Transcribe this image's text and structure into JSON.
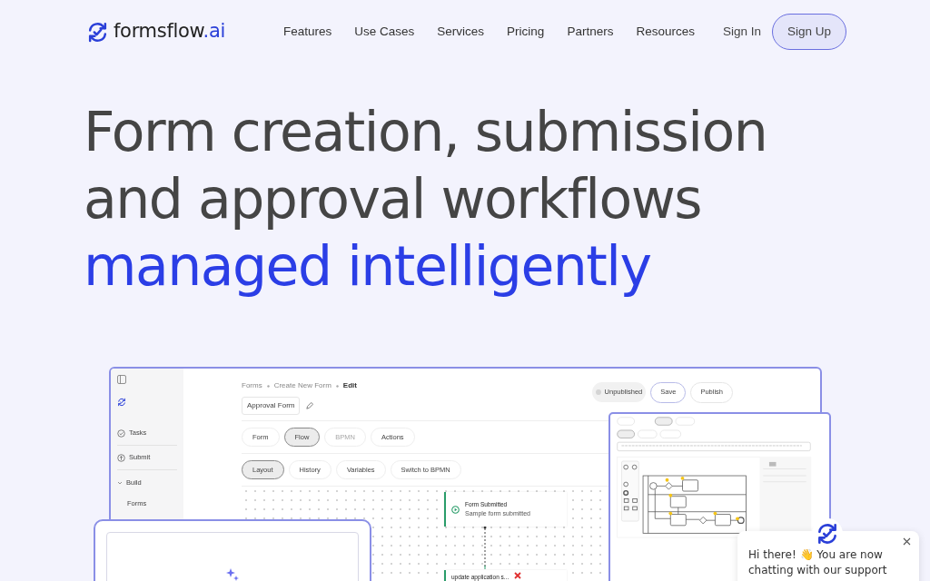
{
  "header": {
    "brand": "formsflow",
    "brand_suffix": ".ai",
    "nav": [
      {
        "label": "Features"
      },
      {
        "label": "Use Cases"
      },
      {
        "label": "Services"
      },
      {
        "label": "Pricing"
      },
      {
        "label": "Partners"
      },
      {
        "label": "Resources"
      }
    ],
    "sign_in": "Sign In",
    "sign_up": "Sign Up"
  },
  "headline": [
    {
      "text": "Form creation, submission",
      "highlight": false
    },
    {
      "text": "and approval workflows",
      "highlight": false
    },
    {
      "text": "managed intelligently",
      "highlight": true
    }
  ],
  "mockup": {
    "sidebar": [
      {
        "label": "Tasks",
        "kind": "check"
      },
      {
        "label": "Submit",
        "kind": "upload"
      },
      {
        "label": "Build",
        "kind": "group",
        "expanded": true
      },
      {
        "label": "Forms",
        "kind": "sub"
      }
    ],
    "breadcrumb": [
      "Forms",
      "Create New Form",
      "Edit"
    ],
    "form_name": "Approval Form",
    "status": "Unpublished",
    "save": "Save",
    "publish": "Publish",
    "tabs": [
      {
        "label": "Form",
        "selected": false,
        "disabled": false
      },
      {
        "label": "Flow",
        "selected": true,
        "disabled": false
      },
      {
        "label": "BPMN",
        "selected": false,
        "disabled": true
      },
      {
        "label": "Actions",
        "selected": false,
        "disabled": false
      }
    ],
    "subtabs": [
      {
        "label": "Layout",
        "selected": true
      },
      {
        "label": "History",
        "selected": false
      },
      {
        "label": "Variables",
        "selected": false
      },
      {
        "label": "Switch to BPMN",
        "selected": false
      }
    ],
    "nodes": [
      {
        "title": "Form Submitted",
        "subtitle": "Sample form submitted",
        "kind": "start"
      },
      {
        "title": "update application s...",
        "kind": "task",
        "error": true
      }
    ]
  },
  "chat": {
    "message": "Hi there! 👋 You are now chatting with our support"
  }
}
